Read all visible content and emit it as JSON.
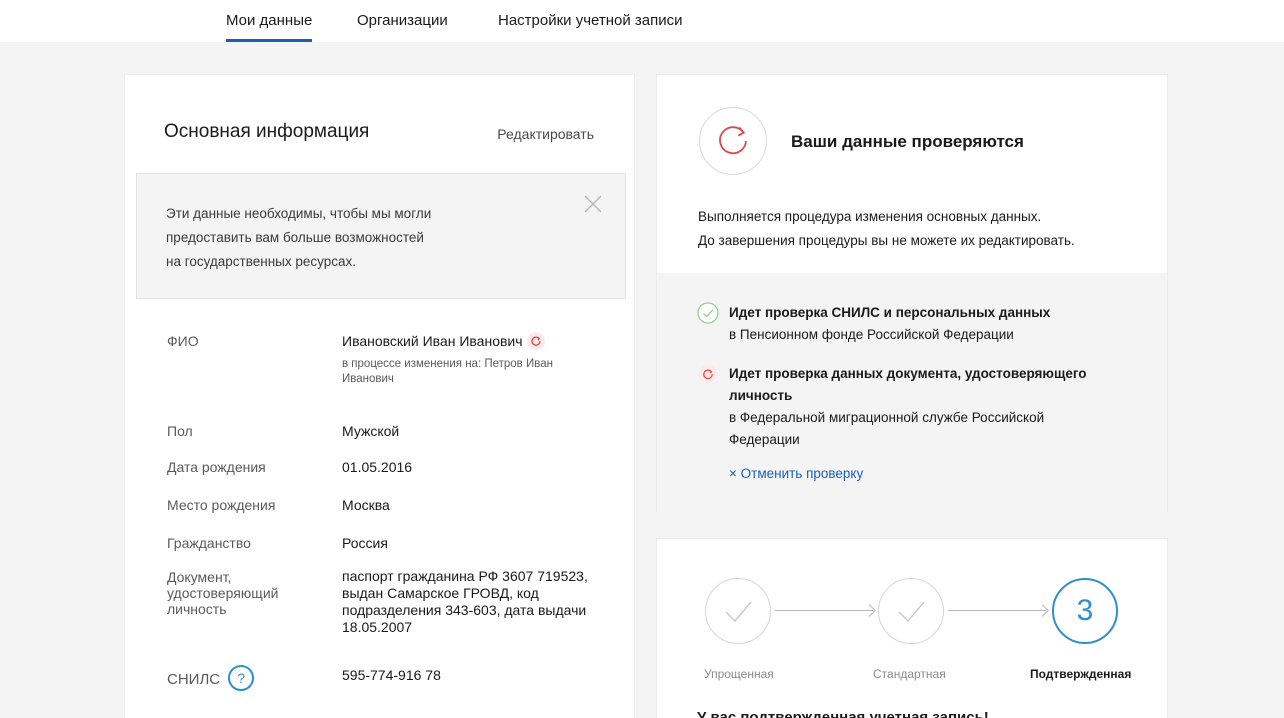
{
  "tabs": [
    {
      "label": "Мои данные",
      "active": true
    },
    {
      "label": "Организации",
      "active": false
    },
    {
      "label": "Настройки учетной записи",
      "active": false
    }
  ],
  "basic_info": {
    "title": "Основная информация",
    "edit_label": "Редактировать",
    "notice_lines": [
      "Эти данные необходимы, чтобы мы могли",
      "предоставить вам больше возможностей",
      "на государственных ресурсах."
    ],
    "fields": [
      {
        "label": "ФИО",
        "value": "Ивановский Иван Иванович",
        "note": "в процессе изменения на: Петров Иван Иванович"
      },
      {
        "label": "Пол",
        "value": "Мужской"
      },
      {
        "label": "Дата рождения",
        "value": "01.05.2016"
      },
      {
        "label": "Место рождения",
        "value": "Москва"
      },
      {
        "label": "Гражданство",
        "value": "Россия"
      },
      {
        "label": "Документ, удостоверяющий личность",
        "value": "паспорт гражданина РФ 3607 719523, выдан Самарское ГРОВД, код подразделения 343-603, дата выдачи 18.05.2007"
      },
      {
        "label": "СНИЛС",
        "value": "595-774-916 78",
        "help_icon": "?"
      }
    ]
  },
  "verification": {
    "title": "Ваши данные проверяются",
    "desc_lines": [
      "Выполняется процедура изменения основных данных.",
      "До завершения процедуры вы не можете их редактировать."
    ],
    "checks": [
      {
        "status": "done",
        "icon": "check-icon",
        "title": "Идет проверка СНИЛС и персональных данных",
        "detail": "в Пенсионном фонде Российской Федерации"
      },
      {
        "status": "pending",
        "icon": "refresh-icon",
        "title": "Идет проверка данных документа, удостоверяющего личность",
        "detail": "в Федеральной миграционной службе Российской Федерации"
      }
    ],
    "cancel_label": "× Отменить проверку"
  },
  "account_levels": {
    "steps": [
      {
        "label": "Упрощенная",
        "state": "passed"
      },
      {
        "label": "Стандартная",
        "state": "passed"
      },
      {
        "label": "Подтвержденная",
        "state": "current",
        "number": "3"
      }
    ],
    "footer": "У вас подтвержденная учетная запись!"
  },
  "colors": {
    "accent": "#1a5fb4",
    "info": "#2f8fcc",
    "success": "#7ec87e",
    "pending": "#e04848"
  }
}
